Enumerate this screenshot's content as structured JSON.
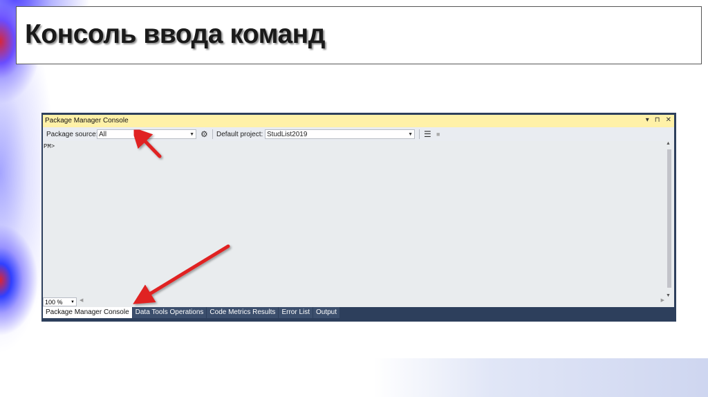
{
  "slide": {
    "title": "Консоль ввода команд"
  },
  "pmc": {
    "title": "Package Manager Console",
    "toolbar": {
      "package_source_label": "Package source:",
      "package_source_value": "All",
      "default_project_label": "Default project:",
      "default_project_value": "StudList2019"
    },
    "prompt": "PM>",
    "zoom": "100 %",
    "tabs": [
      {
        "label": "Package Manager Console",
        "active": true
      },
      {
        "label": "Data Tools Operations"
      },
      {
        "label": "Code Metrics Results"
      },
      {
        "label": "Error List"
      },
      {
        "label": "Output"
      }
    ],
    "window_buttons": [
      "▾",
      "⊓",
      "✕"
    ]
  },
  "colors": {
    "title_bar": "#fff1a8",
    "frame": "#2d3f5c",
    "arrow": "#e02020"
  }
}
